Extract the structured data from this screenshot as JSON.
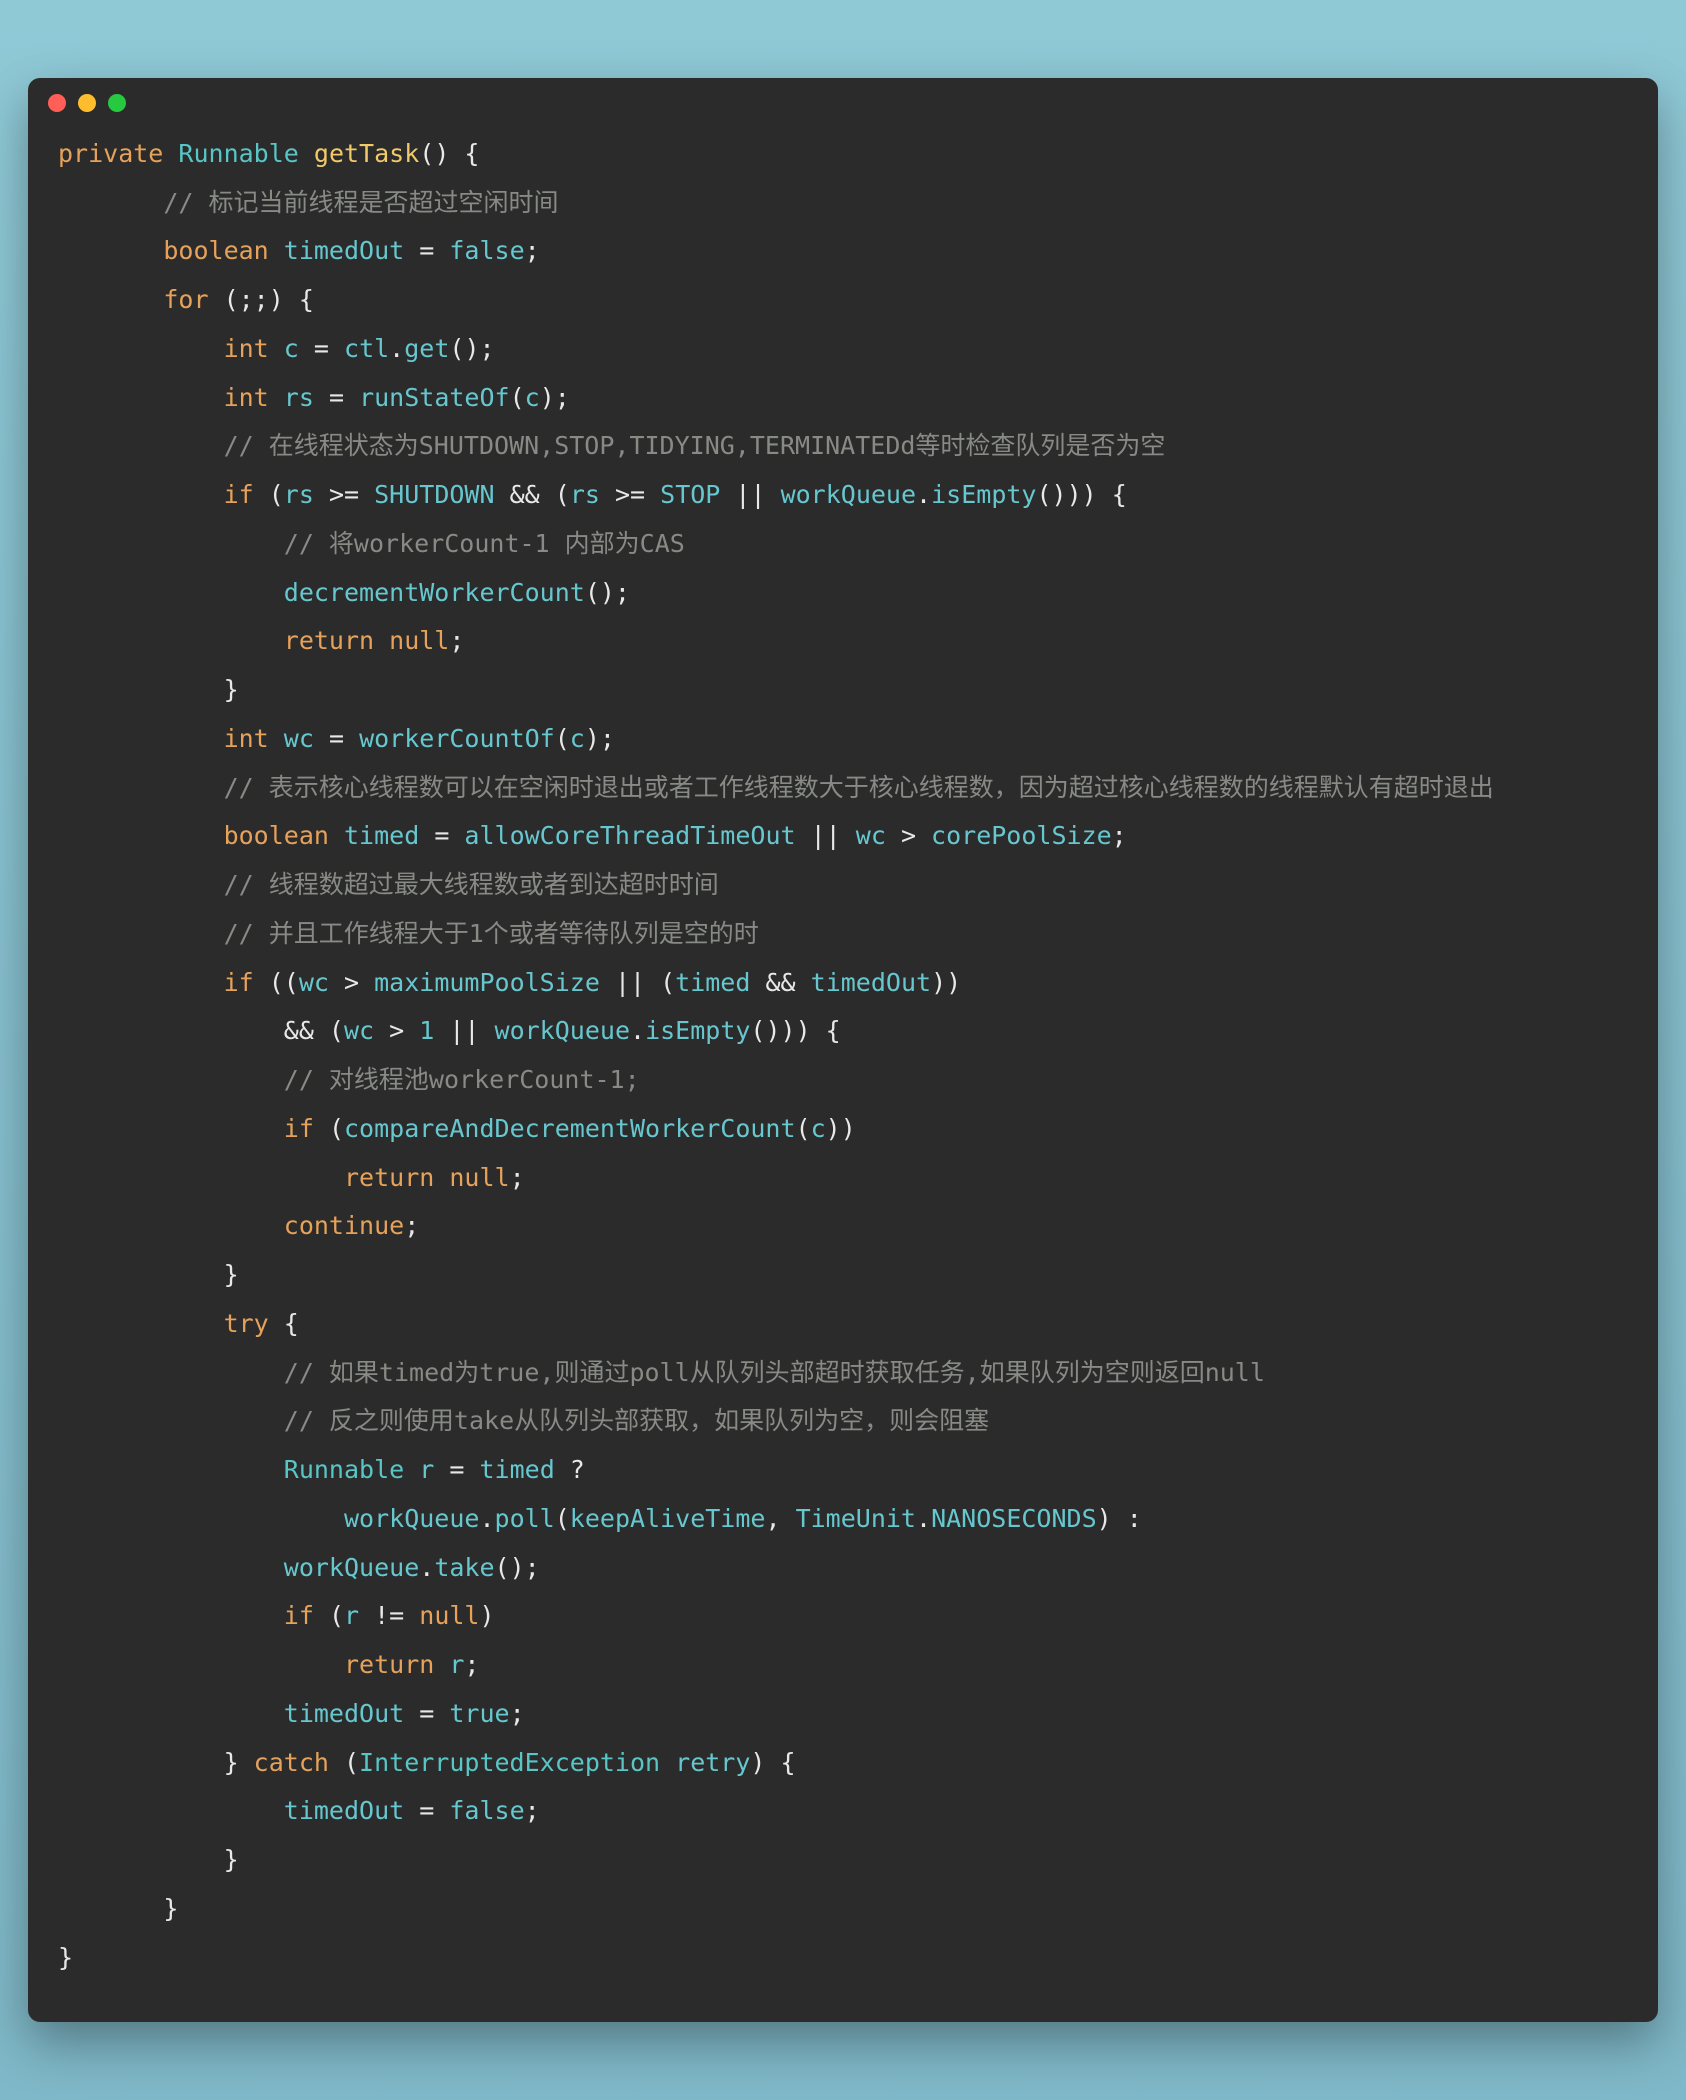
{
  "tokens": [
    [
      [
        "kw-private",
        "private"
      ],
      [
        "kw-punc",
        " "
      ],
      [
        "kw-type",
        "Runnable"
      ],
      [
        "kw-punc",
        " "
      ],
      [
        "kw-method",
        "getTask"
      ],
      [
        "kw-punc",
        "() {"
      ]
    ],
    [
      [
        "kw-punc",
        "       "
      ],
      [
        "kw-comment",
        "// 标记当前线程是否超过空闲时间"
      ]
    ],
    [
      [
        "kw-punc",
        "       "
      ],
      [
        "kw-bool",
        "boolean"
      ],
      [
        "kw-punc",
        " "
      ],
      [
        "kw-ident",
        "timedOut"
      ],
      [
        "kw-punc",
        " = "
      ],
      [
        "kw-false",
        "false"
      ],
      [
        "kw-punc",
        ";"
      ]
    ],
    [
      [
        "kw-punc",
        "       "
      ],
      [
        "kw-for",
        "for"
      ],
      [
        "kw-punc",
        " (;;) {"
      ]
    ],
    [
      [
        "kw-punc",
        "           "
      ],
      [
        "kw-bool",
        "int"
      ],
      [
        "kw-punc",
        " "
      ],
      [
        "kw-ident",
        "c"
      ],
      [
        "kw-punc",
        " = "
      ],
      [
        "kw-ident",
        "ctl"
      ],
      [
        "kw-punc",
        "."
      ],
      [
        "kw-call",
        "get"
      ],
      [
        "kw-punc",
        "();"
      ]
    ],
    [
      [
        "kw-punc",
        "           "
      ],
      [
        "kw-bool",
        "int"
      ],
      [
        "kw-punc",
        " "
      ],
      [
        "kw-ident",
        "rs"
      ],
      [
        "kw-punc",
        " = "
      ],
      [
        "kw-call",
        "runStateOf"
      ],
      [
        "kw-punc",
        "("
      ],
      [
        "kw-ident",
        "c"
      ],
      [
        "kw-punc",
        ");"
      ]
    ],
    [
      [
        "kw-punc",
        "           "
      ],
      [
        "kw-comment",
        "// 在线程状态为SHUTDOWN,STOP,TIDYING,TERMINATEDd等时检查队列是否为空"
      ]
    ],
    [
      [
        "kw-punc",
        "           "
      ],
      [
        "kw-if",
        "if"
      ],
      [
        "kw-punc",
        " ("
      ],
      [
        "kw-ident",
        "rs"
      ],
      [
        "kw-punc",
        " >= "
      ],
      [
        "kw-ident",
        "SHUTDOWN"
      ],
      [
        "kw-punc",
        " && ("
      ],
      [
        "kw-ident",
        "rs"
      ],
      [
        "kw-punc",
        " >= "
      ],
      [
        "kw-ident",
        "STOP"
      ],
      [
        "kw-punc",
        " || "
      ],
      [
        "kw-ident",
        "workQueue"
      ],
      [
        "kw-punc",
        "."
      ],
      [
        "kw-call",
        "isEmpty"
      ],
      [
        "kw-punc",
        "())) {"
      ]
    ],
    [
      [
        "kw-punc",
        "               "
      ],
      [
        "kw-comment",
        "// 将workerCount-1 内部为CAS"
      ]
    ],
    [
      [
        "kw-punc",
        "               "
      ],
      [
        "kw-call",
        "decrementWorkerCount"
      ],
      [
        "kw-punc",
        "();"
      ]
    ],
    [
      [
        "kw-punc",
        "               "
      ],
      [
        "kw-return",
        "return"
      ],
      [
        "kw-punc",
        " "
      ],
      [
        "kw-null",
        "null"
      ],
      [
        "kw-punc",
        ";"
      ]
    ],
    [
      [
        "kw-punc",
        "           }"
      ]
    ],
    [
      [
        "kw-punc",
        "           "
      ],
      [
        "kw-bool",
        "int"
      ],
      [
        "kw-punc",
        " "
      ],
      [
        "kw-ident",
        "wc"
      ],
      [
        "kw-punc",
        " = "
      ],
      [
        "kw-call",
        "workerCountOf"
      ],
      [
        "kw-punc",
        "("
      ],
      [
        "kw-ident",
        "c"
      ],
      [
        "kw-punc",
        ");"
      ]
    ],
    [
      [
        "kw-punc",
        "           "
      ],
      [
        "kw-comment",
        "// 表示核心线程数可以在空闲时退出或者工作线程数大于核心线程数，因为超过核心线程数的线程默认有超时退出"
      ]
    ],
    [
      [
        "kw-punc",
        "           "
      ],
      [
        "kw-bool",
        "boolean"
      ],
      [
        "kw-punc",
        " "
      ],
      [
        "kw-ident",
        "timed"
      ],
      [
        "kw-punc",
        " = "
      ],
      [
        "kw-ident",
        "allowCoreThreadTimeOut"
      ],
      [
        "kw-punc",
        " || "
      ],
      [
        "kw-ident",
        "wc"
      ],
      [
        "kw-punc",
        " > "
      ],
      [
        "kw-ident",
        "corePoolSize"
      ],
      [
        "kw-punc",
        ";"
      ]
    ],
    [
      [
        "kw-punc",
        "           "
      ],
      [
        "kw-comment",
        "// 线程数超过最大线程数或者到达超时时间"
      ]
    ],
    [
      [
        "kw-punc",
        "           "
      ],
      [
        "kw-comment",
        "// 并且工作线程大于1个或者等待队列是空的时"
      ]
    ],
    [
      [
        "kw-punc",
        "           "
      ],
      [
        "kw-if",
        "if"
      ],
      [
        "kw-punc",
        " (("
      ],
      [
        "kw-ident",
        "wc"
      ],
      [
        "kw-punc",
        " > "
      ],
      [
        "kw-ident",
        "maximumPoolSize"
      ],
      [
        "kw-punc",
        " || ("
      ],
      [
        "kw-ident",
        "timed"
      ],
      [
        "kw-punc",
        " && "
      ],
      [
        "kw-ident",
        "timedOut"
      ],
      [
        "kw-punc",
        "))"
      ]
    ],
    [
      [
        "kw-punc",
        "               && ("
      ],
      [
        "kw-ident",
        "wc"
      ],
      [
        "kw-punc",
        " > "
      ],
      [
        "kw-num",
        "1"
      ],
      [
        "kw-punc",
        " || "
      ],
      [
        "kw-ident",
        "workQueue"
      ],
      [
        "kw-punc",
        "."
      ],
      [
        "kw-call",
        "isEmpty"
      ],
      [
        "kw-punc",
        "())) {"
      ]
    ],
    [
      [
        "kw-punc",
        "               "
      ],
      [
        "kw-comment",
        "// 对线程池workerCount-1;"
      ]
    ],
    [
      [
        "kw-punc",
        "               "
      ],
      [
        "kw-if",
        "if"
      ],
      [
        "kw-punc",
        " ("
      ],
      [
        "kw-call",
        "compareAndDecrementWorkerCount"
      ],
      [
        "kw-punc",
        "("
      ],
      [
        "kw-ident",
        "c"
      ],
      [
        "kw-punc",
        "))"
      ]
    ],
    [
      [
        "kw-punc",
        "                   "
      ],
      [
        "kw-return",
        "return"
      ],
      [
        "kw-punc",
        " "
      ],
      [
        "kw-null",
        "null"
      ],
      [
        "kw-punc",
        ";"
      ]
    ],
    [
      [
        "kw-punc",
        "               "
      ],
      [
        "kw-continue",
        "continue"
      ],
      [
        "kw-punc",
        ";"
      ]
    ],
    [
      [
        "kw-punc",
        "           }"
      ]
    ],
    [
      [
        "kw-punc",
        "           "
      ],
      [
        "kw-try",
        "try"
      ],
      [
        "kw-punc",
        " {"
      ]
    ],
    [
      [
        "kw-punc",
        "               "
      ],
      [
        "kw-comment",
        "// 如果timed为true,则通过poll从队列头部超时获取任务,如果队列为空则返回null"
      ]
    ],
    [
      [
        "kw-punc",
        "               "
      ],
      [
        "kw-comment",
        "// 反之则使用take从队列头部获取，如果队列为空，则会阻塞"
      ]
    ],
    [
      [
        "kw-punc",
        "               "
      ],
      [
        "kw-type",
        "Runnable"
      ],
      [
        "kw-punc",
        " "
      ],
      [
        "kw-ident",
        "r"
      ],
      [
        "kw-punc",
        " = "
      ],
      [
        "kw-ident",
        "timed"
      ],
      [
        "kw-punc",
        " ?"
      ]
    ],
    [
      [
        "kw-punc",
        "                   "
      ],
      [
        "kw-ident",
        "workQueue"
      ],
      [
        "kw-punc",
        "."
      ],
      [
        "kw-call",
        "poll"
      ],
      [
        "kw-punc",
        "("
      ],
      [
        "kw-ident",
        "keepAliveTime"
      ],
      [
        "kw-punc",
        ", "
      ],
      [
        "kw-ident",
        "TimeUnit"
      ],
      [
        "kw-punc",
        "."
      ],
      [
        "kw-ident",
        "NANOSECONDS"
      ],
      [
        "kw-punc",
        ") :"
      ]
    ],
    [
      [
        "kw-punc",
        "               "
      ],
      [
        "kw-ident",
        "workQueue"
      ],
      [
        "kw-punc",
        "."
      ],
      [
        "kw-call",
        "take"
      ],
      [
        "kw-punc",
        "();"
      ]
    ],
    [
      [
        "kw-punc",
        "               "
      ],
      [
        "kw-if",
        "if"
      ],
      [
        "kw-punc",
        " ("
      ],
      [
        "kw-ident",
        "r"
      ],
      [
        "kw-punc",
        " != "
      ],
      [
        "kw-null",
        "null"
      ],
      [
        "kw-punc",
        ")"
      ]
    ],
    [
      [
        "kw-punc",
        "                   "
      ],
      [
        "kw-return",
        "return"
      ],
      [
        "kw-punc",
        " "
      ],
      [
        "kw-ident",
        "r"
      ],
      [
        "kw-punc",
        ";"
      ]
    ],
    [
      [
        "kw-punc",
        "               "
      ],
      [
        "kw-ident",
        "timedOut"
      ],
      [
        "kw-punc",
        " = "
      ],
      [
        "kw-true",
        "true"
      ],
      [
        "kw-punc",
        ";"
      ]
    ],
    [
      [
        "kw-punc",
        "           } "
      ],
      [
        "kw-catch",
        "catch"
      ],
      [
        "kw-punc",
        " ("
      ],
      [
        "kw-type",
        "InterruptedException"
      ],
      [
        "kw-punc",
        " "
      ],
      [
        "kw-ident",
        "retry"
      ],
      [
        "kw-punc",
        ") {"
      ]
    ],
    [
      [
        "kw-punc",
        "               "
      ],
      [
        "kw-ident",
        "timedOut"
      ],
      [
        "kw-punc",
        " = "
      ],
      [
        "kw-false",
        "false"
      ],
      [
        "kw-punc",
        ";"
      ]
    ],
    [
      [
        "kw-punc",
        "           }"
      ]
    ],
    [
      [
        "kw-punc",
        "       }"
      ]
    ],
    [
      [
        "kw-punc",
        "}"
      ]
    ]
  ]
}
